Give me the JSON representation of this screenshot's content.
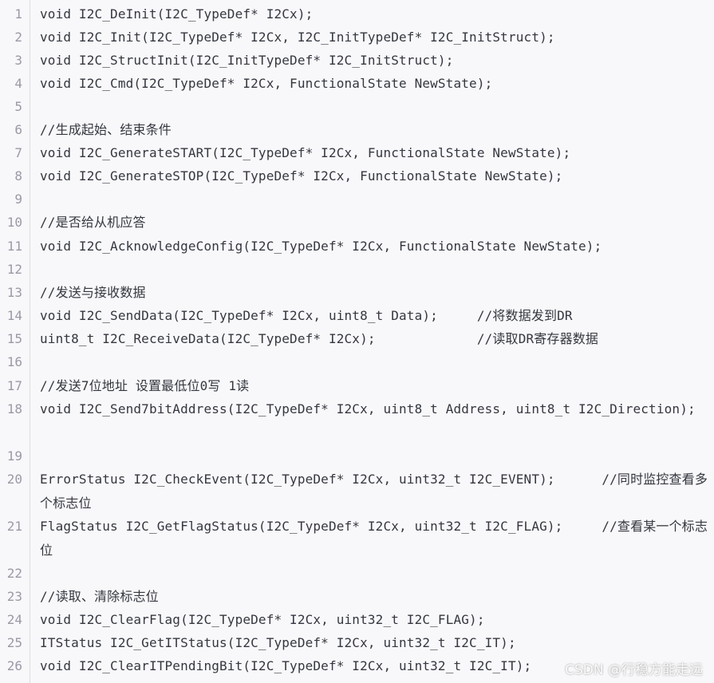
{
  "lines": [
    {
      "n": "1",
      "text": "void I2C_DeInit(I2C_TypeDef* I2Cx);"
    },
    {
      "n": "2",
      "text": "void I2C_Init(I2C_TypeDef* I2Cx, I2C_InitTypeDef* I2C_InitStruct);"
    },
    {
      "n": "3",
      "text": "void I2C_StructInit(I2C_InitTypeDef* I2C_InitStruct);"
    },
    {
      "n": "4",
      "text": "void I2C_Cmd(I2C_TypeDef* I2Cx, FunctionalState NewState);"
    },
    {
      "n": "5",
      "text": ""
    },
    {
      "n": "6",
      "text": "//生成起始、结束条件"
    },
    {
      "n": "7",
      "text": "void I2C_GenerateSTART(I2C_TypeDef* I2Cx, FunctionalState NewState);"
    },
    {
      "n": "8",
      "text": "void I2C_GenerateSTOP(I2C_TypeDef* I2Cx, FunctionalState NewState);"
    },
    {
      "n": "9",
      "text": ""
    },
    {
      "n": "10",
      "text": "//是否给从机应答"
    },
    {
      "n": "11",
      "text": "void I2C_AcknowledgeConfig(I2C_TypeDef* I2Cx, FunctionalState NewState);"
    },
    {
      "n": "12",
      "text": ""
    },
    {
      "n": "13",
      "text": "//发送与接收数据"
    },
    {
      "n": "14",
      "text": "void I2C_SendData(I2C_TypeDef* I2Cx, uint8_t Data);     //将数据发到DR"
    },
    {
      "n": "15",
      "text": "uint8_t I2C_ReceiveData(I2C_TypeDef* I2Cx);             //读取DR寄存器数据"
    },
    {
      "n": "16",
      "text": ""
    },
    {
      "n": "17",
      "text": "//发送7位地址 设置最低位0写 1读"
    },
    {
      "n": "18",
      "text": "void I2C_Send7bitAddress(I2C_TypeDef* I2Cx, uint8_t Address, uint8_t I2C_Direction);"
    },
    {
      "n": "19",
      "text": ""
    },
    {
      "n": "20",
      "text": "ErrorStatus I2C_CheckEvent(I2C_TypeDef* I2Cx, uint32_t I2C_EVENT);      //同时监控查看多个标志位"
    },
    {
      "n": "21",
      "text": "FlagStatus I2C_GetFlagStatus(I2C_TypeDef* I2Cx, uint32_t I2C_FLAG);     //查看某一个标志位"
    },
    {
      "n": "22",
      "text": ""
    },
    {
      "n": "23",
      "text": "//读取、清除标志位"
    },
    {
      "n": "24",
      "text": "void I2C_ClearFlag(I2C_TypeDef* I2Cx, uint32_t I2C_FLAG);"
    },
    {
      "n": "25",
      "text": "ITStatus I2C_GetITStatus(I2C_TypeDef* I2Cx, uint32_t I2C_IT);"
    },
    {
      "n": "26",
      "text": "void I2C_ClearITPendingBit(I2C_TypeDef* I2Cx, uint32_t I2C_IT);"
    }
  ],
  "watermark": "CSDN @行稳方能走远"
}
